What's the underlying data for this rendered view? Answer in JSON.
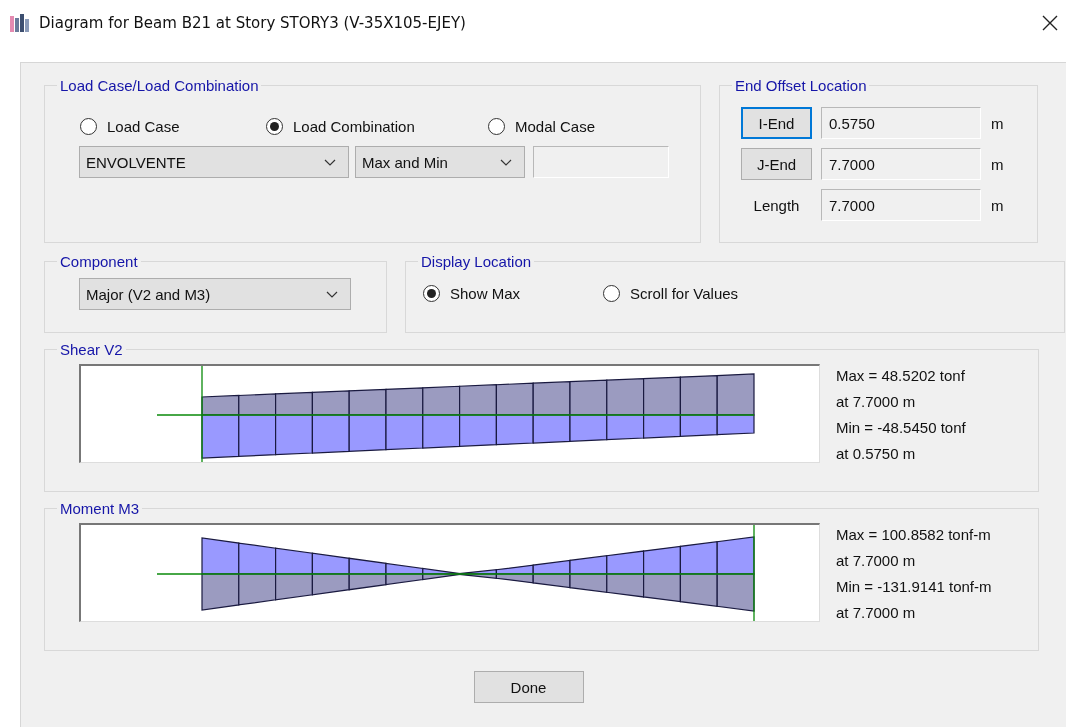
{
  "window": {
    "title": "Diagram for Beam B21 at Story STORY3 (V-35X105-EJEY)"
  },
  "load_case_group": {
    "title": "Load Case/Load Combination",
    "options": [
      {
        "label": "Load Case",
        "selected": false
      },
      {
        "label": "Load Combination",
        "selected": true
      },
      {
        "label": "Modal Case",
        "selected": false
      }
    ],
    "combination": "ENVOLVENTE",
    "mode": "Max and Min"
  },
  "end_offset": {
    "title": "End Offset Location",
    "rows": [
      {
        "kind": "button",
        "label": "I-End",
        "focused": true,
        "value": "0.5750",
        "unit": "m"
      },
      {
        "kind": "button",
        "label": "J-End",
        "focused": false,
        "value": "7.7000",
        "unit": "m"
      },
      {
        "kind": "label",
        "label": "Length",
        "value": "7.7000",
        "unit": "m"
      }
    ]
  },
  "component": {
    "title": "Component",
    "value": "Major (V2 and M3)"
  },
  "display_location": {
    "title": "Display Location",
    "options": [
      {
        "label": "Show Max",
        "selected": true
      },
      {
        "label": "Scroll for Values",
        "selected": false
      }
    ]
  },
  "diagrams": [
    {
      "kind": "shear",
      "title": "Shear V2",
      "results": [
        "Max = 48.5202 tonf",
        "at 7.7000 m",
        "Min = -48.5450 tonf",
        "at 0.5750 m"
      ]
    },
    {
      "kind": "moment",
      "title": "Moment M3",
      "results": [
        "Max = 100.8582 tonf-m",
        "at 7.7000 m",
        "Min = -131.9141 tonf-m",
        "at 7.7000 m"
      ]
    }
  ],
  "done_button": "Done"
}
